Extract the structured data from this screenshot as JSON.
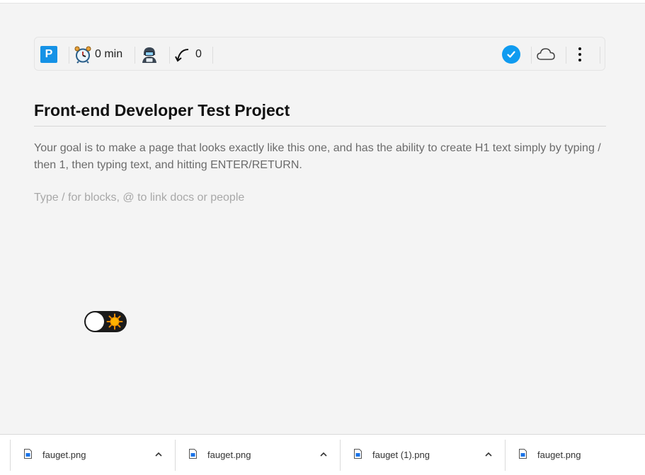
{
  "toolbar": {
    "project_badge": "P",
    "timer_icon": "alarm-clock-icon",
    "timer_label": "0 min",
    "avatar_icon": "hacker-avatar-icon",
    "undo_icon": "curved-arrow-icon",
    "undo_count": "0",
    "status_icon": "check-circle-icon",
    "cloud_icon": "cloud-icon",
    "menu_icon": "kebab-menu-icon"
  },
  "document": {
    "title": "Front-end Developer Test Project",
    "description": "Your goal is to make a page that looks exactly like this one, and has the ability to create H1 text simply by typing / then 1, then typing text, and hitting ENTER/RETURN.",
    "input_placeholder": "Type / for blocks, @ to link docs or people"
  },
  "theme_toggle": {
    "state": "light",
    "icon": "sun-icon"
  },
  "downloads": [
    {
      "name": "fauget.png",
      "icon": "file-icon"
    },
    {
      "name": "fauget.png",
      "icon": "file-icon"
    },
    {
      "name": "fauget (1).png",
      "icon": "file-icon"
    },
    {
      "name": "fauget.png",
      "icon": "file-icon"
    }
  ],
  "colors": {
    "page_background": "#f4f4f4",
    "badge_blue": "#1592e6",
    "check_blue": "#0f9bf0",
    "toggle_dark": "#1b1b1b",
    "sun_yellow": "#ffb300"
  }
}
